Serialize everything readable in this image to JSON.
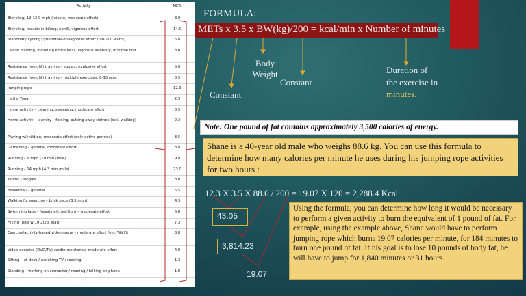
{
  "table": {
    "headers": [
      "Activity",
      "METs"
    ],
    "rows": [
      {
        "activity": "Bicycling; 12-13.9 mph (leisure, moderate effort)",
        "mets": "8.0"
      },
      {
        "activity": "Bicycling; mountain-biking, uphill, vigorous effort",
        "mets": "14.0"
      },
      {
        "activity": "Stationary cycling; (moderate-to-vigorous effort / 90-100 watts)",
        "mets": "6.8"
      },
      {
        "activity": "Circuit training, including kettle bells, vigorous intensity, minimal rest",
        "mets": "8.0",
        "tall": true
      },
      {
        "activity": "Resistance (weight) training – squats, explosive effort",
        "mets": "5.0"
      },
      {
        "activity": "Resistance (weight) training – multiple exercises, 8-15 reps",
        "mets": "3.5"
      },
      {
        "activity": "Jumping rope",
        "mets": "12.3"
      },
      {
        "activity": "Hatha Yoga",
        "mets": "2.5"
      },
      {
        "activity": "Home activity – cleaning, sweeping, moderate effort",
        "mets": "3.5"
      },
      {
        "activity": "Home activity – laundry – folding, putting away clothes (incl. walking)",
        "mets": "2.3",
        "tall": true
      },
      {
        "activity": "Playing w/children, moderate effort (only active periods)",
        "mets": "3.5"
      },
      {
        "activity": "Gardening – general, moderate effort",
        "mets": "3.8"
      },
      {
        "activity": "Running – 6 mph (10 min./mile)",
        "mets": "9.8"
      },
      {
        "activity": "Running – 14 mph (4.3 min./mile)",
        "mets": "23.0"
      },
      {
        "activity": "Tennis – singles",
        "mets": "8.0"
      },
      {
        "activity": "Basketball – general",
        "mets": "6.5"
      },
      {
        "activity": "Walking for exercise – brisk pace (3.5 mph)",
        "mets": "4.3"
      },
      {
        "activity": "Swimming laps – freestyle/crawl light – moderate effort",
        "mets": "5.8"
      },
      {
        "activity": "Hiking (hills w/10-20lb. load)",
        "mets": "7.3"
      },
      {
        "activity": "Exercise/activity-based video game – moderate effort (e.g. Wii Fit)",
        "mets": "3.8",
        "tall": true
      },
      {
        "activity": "Video-exercise (DVD/TV) cardio-resistance, moderate effort",
        "mets": "4.0"
      },
      {
        "activity": "Sitting – at desk / watching TV / reading",
        "mets": "1.3"
      },
      {
        "activity": "Standing – working on computer / reading / talking on phone",
        "mets": "1.8"
      }
    ]
  },
  "formula": {
    "title": "FORMULA:",
    "text": "METs x 3.5 x BW(kg)/200 = kcal/min x Number of minutes"
  },
  "labels": {
    "constant1": "Constant",
    "body": "Body",
    "weight": "Weight",
    "constant2": "Constant",
    "duration1": "Duration of",
    "duration2": "the exercise in",
    "duration3": "minutes."
  },
  "note": "Note: One pound of fat contains approximately 3,500 calories of energy.",
  "example": "Shane is a 40-year old male who weighs 88.6 kg. You can use this formula to determine how many calories per minute he uses during his jumping rope activities for two hours :",
  "equation": "12.3 X 3.5 X 88.6 / 200 = 19.07 X 120 = 2,288.4 Kcal",
  "steps": [
    "43.05",
    "3,814.23",
    "19.07"
  ],
  "explanation": "Using the formula, you can determine how long it would be necessary to perform a given activity to burn the equivalent of 1 pound of fat. For example, using the example above, Shane would have to perform jumping rope which burns 19.07 calories per minute, for 184 minutes to burn one pound of fat. If his goal is to lose 10 pounds of body fat, he will have to jump for 1,840 minutes or 31 hours."
}
